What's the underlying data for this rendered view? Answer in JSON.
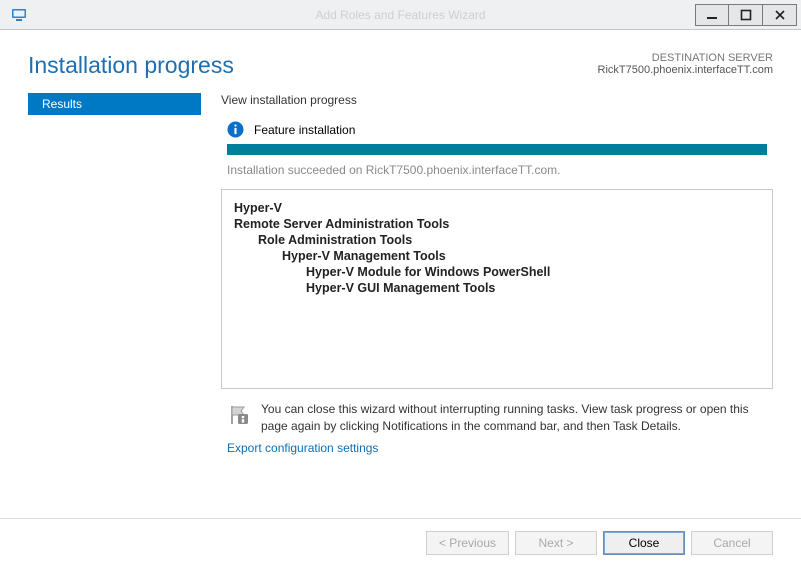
{
  "window": {
    "title": "Add Roles and Features Wizard"
  },
  "header": {
    "title": "Installation progress",
    "dest_label": "DESTINATION SERVER",
    "dest_server": "RickT7500.phoenix.interfaceTT.com"
  },
  "sidebar": {
    "items": [
      {
        "label": "Results",
        "selected": true
      }
    ]
  },
  "main": {
    "view_label": "View installation progress",
    "status_title": "Feature installation",
    "status_message": "Installation succeeded on RickT7500.phoenix.interfaceTT.com.",
    "progress_percent": 100,
    "features": [
      {
        "label": "Hyper-V",
        "indent": 0
      },
      {
        "label": "Remote Server Administration Tools",
        "indent": 1
      },
      {
        "label": "Role Administration Tools",
        "indent": 2
      },
      {
        "label": "Hyper-V Management Tools",
        "indent": 3
      },
      {
        "label": "Hyper-V Module for Windows PowerShell",
        "indent": 4
      },
      {
        "label": "Hyper-V GUI Management Tools",
        "indent": 4
      }
    ],
    "note": "You can close this wizard without interrupting running tasks. View task progress or open this page again by clicking Notifications in the command bar, and then Task Details.",
    "export_link": "Export configuration settings"
  },
  "footer": {
    "previous": "< Previous",
    "next": "Next >",
    "close": "Close",
    "cancel": "Cancel"
  }
}
